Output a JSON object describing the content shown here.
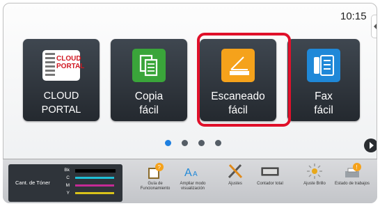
{
  "status": {
    "time": "10:15"
  },
  "apps": [
    {
      "id": "cloud-portal",
      "label": "CLOUD PORTAL",
      "logo_lines": [
        "CLOUD",
        "PORTAL"
      ]
    },
    {
      "id": "copy",
      "label_lines": [
        "Copia",
        "fácil"
      ]
    },
    {
      "id": "scan",
      "label_lines": [
        "Escaneado",
        "fácil"
      ],
      "selected": true
    },
    {
      "id": "fax",
      "label_lines": [
        "Fax",
        "fácil"
      ]
    }
  ],
  "pager": {
    "pages": 4,
    "current": 1
  },
  "toner": {
    "title": "Cant. de Tóner",
    "levels": [
      {
        "code": "Bk",
        "color": "#000000",
        "level": 1.0
      },
      {
        "code": "C",
        "color": "#1fbfd6",
        "level": 1.0
      },
      {
        "code": "M",
        "color": "#c42a95",
        "level": 1.0
      },
      {
        "code": "Y",
        "color": "#d8c21a",
        "level": 1.0
      }
    ]
  },
  "functions": [
    {
      "id": "operation-guide",
      "label": "Guía de Funcionamiento",
      "icon": "book-help-icon"
    },
    {
      "id": "enlarge-display",
      "label": "Ampliar modo visualización",
      "icon": "font-enlarge-icon"
    },
    {
      "id": "settings",
      "label": "Ajustes",
      "icon": "tools-icon"
    },
    {
      "id": "total-count",
      "label": "Contador total",
      "icon": "counter-icon"
    },
    {
      "id": "brightness",
      "label": "Ajuste Brillo",
      "icon": "brightness-icon"
    },
    {
      "id": "job-status",
      "label": "Estado de trabajos",
      "icon": "printer-alert-icon"
    }
  ],
  "colors": {
    "accent": "#1e7fe0",
    "highlight": "#e0102a",
    "tile": "#2f353c",
    "scan_icon": "#f5a21b",
    "copy_icon": "#3aa53a",
    "fax_icon": "#1f88d8"
  }
}
